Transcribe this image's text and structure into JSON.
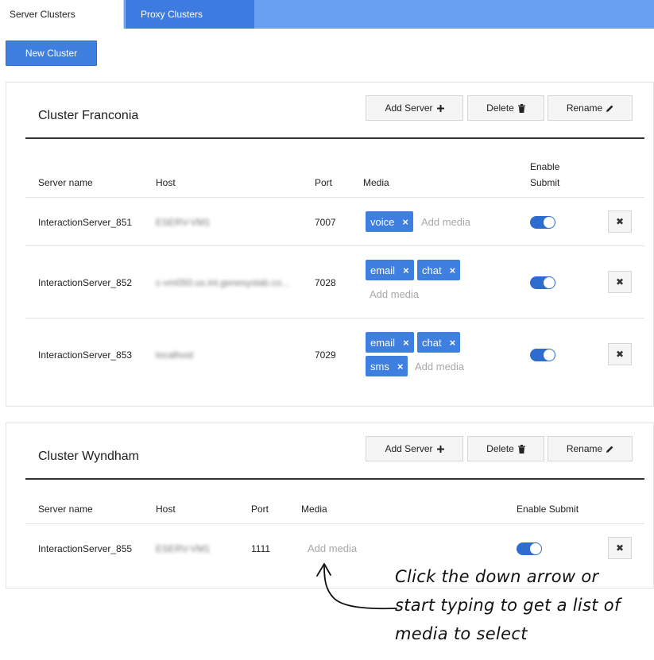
{
  "tabs": [
    {
      "label": "Server Clusters",
      "active": true
    },
    {
      "label": "Proxy Clusters",
      "active": false
    }
  ],
  "new_cluster_label": "New Cluster",
  "actions": {
    "add_server": "Add Server",
    "delete": "Delete",
    "rename": "Rename"
  },
  "columns": {
    "server_name": "Server name",
    "host": "Host",
    "port": "Port",
    "media": "Media",
    "enable_submit_line1": "Enable",
    "enable_submit_line2": "Submit",
    "enable_submit": "Enable Submit"
  },
  "add_media_placeholder": "Add media",
  "clusters": [
    {
      "name": "Cluster Franconia",
      "servers": [
        {
          "name": "InteractionServer_851",
          "host": "ESERV-VM1",
          "port": "7007",
          "media": [
            "voice"
          ],
          "enable_submit": true
        },
        {
          "name": "InteractionServer_852",
          "host": "c-vm050.us.int.genesyslab.co...",
          "port": "7028",
          "media": [
            "email",
            "chat"
          ],
          "enable_submit": true
        },
        {
          "name": "InteractionServer_853",
          "host": "localhost",
          "port": "7029",
          "media": [
            "email",
            "chat",
            "sms"
          ],
          "enable_submit": true
        }
      ]
    },
    {
      "name": "Cluster Wyndham",
      "servers": [
        {
          "name": "InteractionServer_855",
          "host": "ESERV-VM1",
          "port": "1111",
          "media": [],
          "enable_submit": true
        }
      ]
    }
  ],
  "annotation": {
    "lines": [
      "Click the down arrow or",
      "start typing to get a list of",
      "media to select"
    ]
  },
  "colors": {
    "tab_bar": "#6aa0f2",
    "accent": "#3f7fe0",
    "toggle_on": "#2f6cd0"
  },
  "icons": {
    "add": "plus-icon",
    "delete": "trash-icon",
    "rename": "pencil-icon",
    "remove": "close-icon"
  }
}
